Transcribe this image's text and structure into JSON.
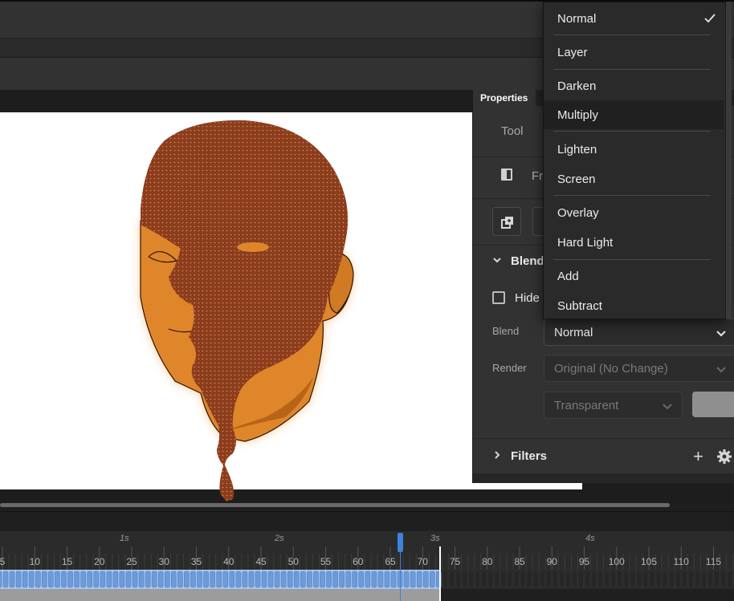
{
  "properties": {
    "tab_title": "Properties",
    "tool_label": "Tool",
    "frame_label": "Fra",
    "blending_section": "Blend",
    "hide_label": "Hide",
    "blend_label": "Blend",
    "blend_value": "Normal",
    "render_label": "Render",
    "render_value": "Original (No Change)",
    "transparent_value": "Transparent",
    "filters_section": "Filters"
  },
  "blend_dropdown": {
    "options": [
      "Normal",
      "Layer",
      "Darken",
      "Multiply",
      "Lighten",
      "Screen",
      "Overlay",
      "Hard Light",
      "Add",
      "Subtract"
    ],
    "selected": "Normal",
    "highlighted": "Multiply"
  },
  "timeline": {
    "seconds": [
      "1s",
      "2s",
      "3s",
      "4s"
    ],
    "frames": [
      "5",
      "10",
      "15",
      "20",
      "25",
      "30",
      "35",
      "40",
      "45",
      "50",
      "55",
      "60",
      "65",
      "70",
      "75",
      "80",
      "85",
      "90",
      "95",
      "100",
      "105",
      "110",
      "115"
    ],
    "current_frame": 66,
    "last_frame": 72
  },
  "colors": {
    "accent": "#3e82e0",
    "artwork_skin": "#e08a2a",
    "artwork_overlay": "#8a3a1c",
    "panel_bg": "#323232",
    "keyframe_track": "#a9c7f0"
  },
  "icons": [
    "checkmark-icon",
    "chevron-down-icon",
    "chevron-right-icon",
    "plus-icon",
    "gear-icon",
    "frame-icon",
    "break-apart-icon"
  ]
}
